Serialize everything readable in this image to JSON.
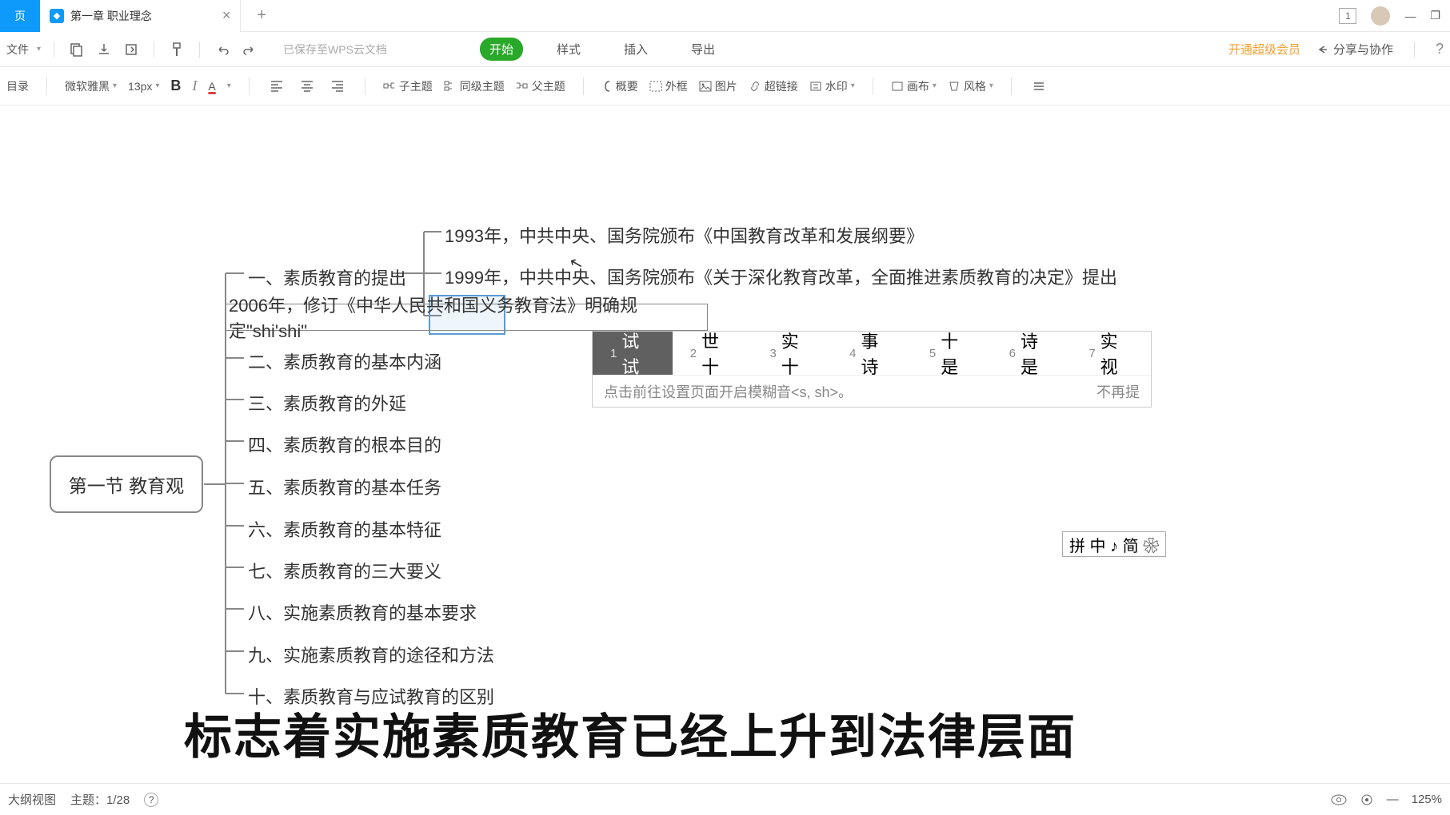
{
  "titlebar": {
    "home_tab": "页",
    "tab_title": "第一章 职业理念",
    "window_count": "1"
  },
  "toolbar1": {
    "file_menu": "文件",
    "cloud_status": "已保存至WPS云文档",
    "tabs": {
      "start": "开始",
      "style": "样式",
      "insert": "插入",
      "export": "导出"
    },
    "vip": "开通超级会员",
    "share": "分享与协作"
  },
  "toolbar2": {
    "catalog": "目录",
    "font_name": "微软雅黑",
    "font_size": "13px",
    "subtopic": "子主题",
    "sibling": "同级主题",
    "parent": "父主题",
    "summary": "概要",
    "outline": "外框",
    "image": "图片",
    "link": "超链接",
    "watermark": "水印",
    "canvas": "画布",
    "style": "风格"
  },
  "mindmap": {
    "root": "第一节 教育观",
    "branches": [
      "一、素质教育的提出",
      "二、素质教育的基本内涵",
      "三、素质教育的外延",
      "四、素质教育的根本目的",
      "五、素质教育的基本任务",
      "六、素质教育的基本特征",
      "七、素质教育的三大要义",
      "八、实施素质教育的基本要求",
      "九、实施素质教育的途径和方法",
      "十、素质教育与应试教育的区别"
    ],
    "sub1": [
      "1993年，中共中央、国务院颁布《中国教育改革和发展纲要》",
      "1999年，中共中央、国务院颁布《关于深化教育改革，全面推进素质教育的决定》提出"
    ],
    "editing": "2006年，修订《中华人民共和国义务教育法》明确规定\"shi'shi\""
  },
  "ime": {
    "candidates": [
      {
        "num": "1",
        "text": "试试"
      },
      {
        "num": "2",
        "text": "世十"
      },
      {
        "num": "3",
        "text": "实十"
      },
      {
        "num": "4",
        "text": "事诗"
      },
      {
        "num": "5",
        "text": "十是"
      },
      {
        "num": "6",
        "text": "诗是"
      },
      {
        "num": "7",
        "text": "实视"
      }
    ],
    "hint": "点击前往设置页面开启模糊音<s, sh>。",
    "hint_right": "不再提",
    "status": "拼 中 ♪ 简 ❀"
  },
  "subtitle": "标志着实施素质教育已经上升到法律层面",
  "statusbar": {
    "outline_view": "大纲视图",
    "topic_count": "主题：1/28",
    "zoom": "125%"
  }
}
